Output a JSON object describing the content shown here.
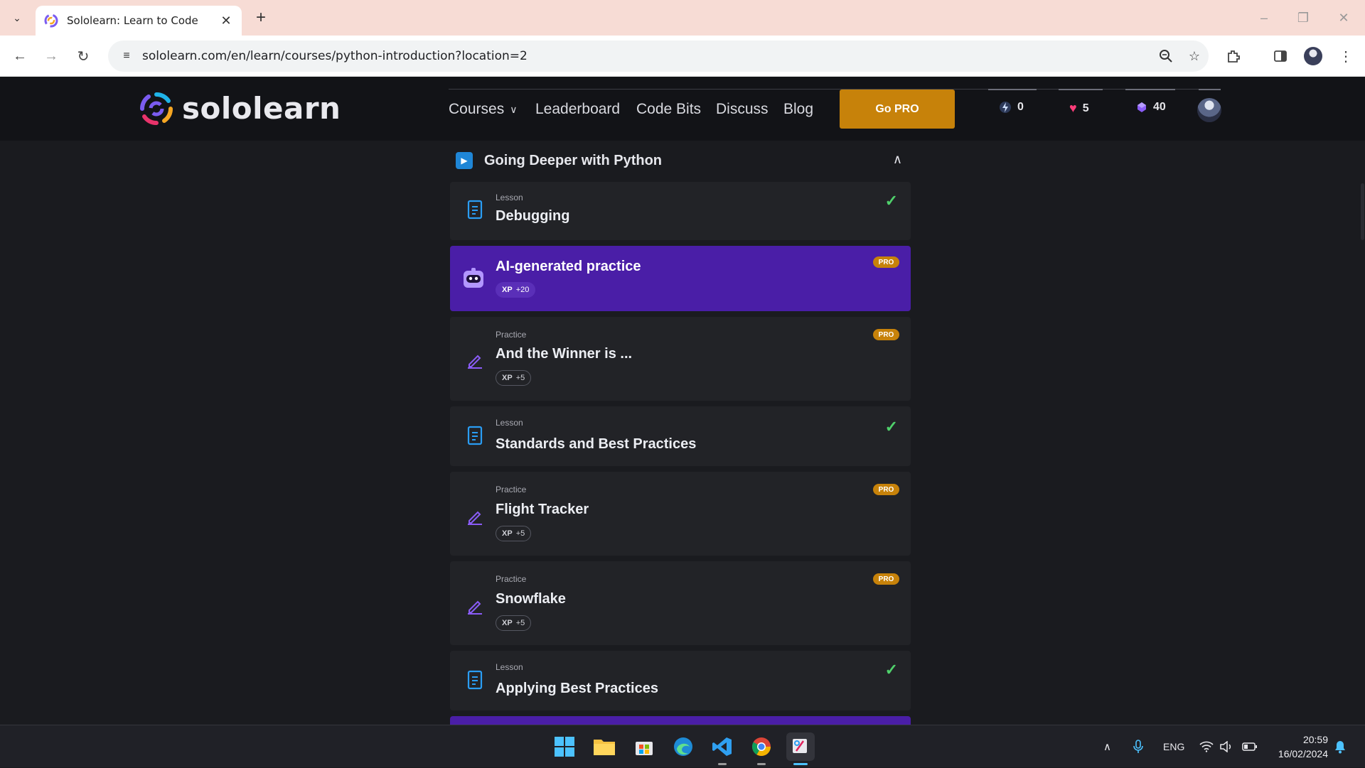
{
  "browser": {
    "tab_title": "Sololearn: Learn to Code",
    "url": "sololearn.com/en/learn/courses/python-introduction?location=2",
    "icons": [
      "tab-search-icon",
      "close-icon",
      "plus-icon",
      "minimize-icon",
      "restore-icon",
      "window-close-icon",
      "back-icon",
      "forward-icon",
      "reload-icon",
      "site-settings-icon",
      "zoom-icon",
      "star-icon",
      "extensions-icon",
      "side-panel-icon",
      "profile-avatar",
      "menu-icon"
    ]
  },
  "header": {
    "logo_text": "sololearn",
    "nav": [
      {
        "label": "Courses",
        "has_dropdown": true
      },
      {
        "label": "Leaderboard"
      },
      {
        "label": "Code Bits"
      },
      {
        "label": "Discuss"
      },
      {
        "label": "Blog"
      }
    ],
    "go_pro": "Go PRO",
    "stats": {
      "streak": "0",
      "hearts": "5",
      "gems": "40"
    },
    "colors": {
      "pro": "#c7820a",
      "streak": "#3a87ff",
      "hearts": "#ff3d7a",
      "gems": "#8a5cf6"
    }
  },
  "section": {
    "title": "Going Deeper with Python",
    "expanded": true
  },
  "items": [
    {
      "type": "Lesson",
      "title": "Debugging",
      "completed": true
    },
    {
      "type": "",
      "title": "AI-generated practice",
      "xp_label": "XP",
      "xp_value": "+20",
      "pro": "PRO"
    },
    {
      "type": "Practice",
      "title": "And the Winner is ...",
      "xp_label": "XP",
      "xp_value": "+5",
      "pro": "PRO"
    },
    {
      "type": "Lesson",
      "title": "Standards and Best Practices",
      "completed": true
    },
    {
      "type": "Practice",
      "title": "Flight Tracker",
      "xp_label": "XP",
      "xp_value": "+5",
      "pro": "PRO"
    },
    {
      "type": "Practice",
      "title": "Snowflake",
      "xp_label": "XP",
      "xp_value": "+5",
      "pro": "PRO"
    },
    {
      "type": "Lesson",
      "title": "Applying Best Practices",
      "completed": true
    }
  ],
  "taskbar": {
    "apps": [
      "windows-start",
      "file-explorer",
      "microsoft-store",
      "edge",
      "vscode",
      "chrome",
      "snipping-tool"
    ],
    "language": "ENG",
    "time": "20:59",
    "date": "16/02/2024"
  }
}
